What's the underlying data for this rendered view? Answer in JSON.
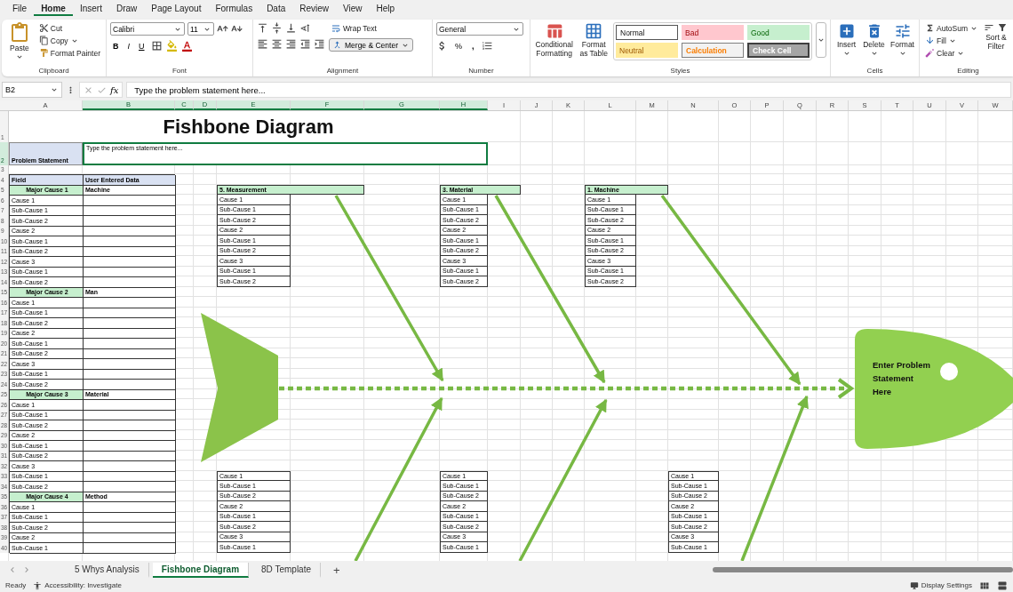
{
  "menu": [
    {
      "label": "File",
      "selected": false
    },
    {
      "label": "Home",
      "selected": true
    },
    {
      "label": "Insert",
      "selected": false
    },
    {
      "label": "Draw",
      "selected": false
    },
    {
      "label": "Page Layout",
      "selected": false
    },
    {
      "label": "Formulas",
      "selected": false
    },
    {
      "label": "Data",
      "selected": false
    },
    {
      "label": "Review",
      "selected": false
    },
    {
      "label": "View",
      "selected": false
    },
    {
      "label": "Help",
      "selected": false
    }
  ],
  "ribbon": [
    {
      "kind": "clipboard",
      "label": "Clipboard",
      "paste": "Paste",
      "cut": "Cut",
      "copy": "Copy",
      "format_painter": "Format Painter"
    },
    {
      "kind": "font",
      "label": "Font",
      "font_name": "Calibri",
      "font_size": "11",
      "bold": "B",
      "italic": "I",
      "underline": "U"
    },
    {
      "kind": "alignment",
      "label": "Alignment",
      "wrap_text": "Wrap Text",
      "merge_center": "Merge & Center"
    },
    {
      "kind": "number",
      "label": "Number",
      "format": "General",
      "percent": "%",
      "comma": ","
    },
    {
      "kind": "styles",
      "label": "Styles",
      "conditional_formatting": "Conditional Formatting",
      "format_as_table": "Format as Table",
      "cell_styles": [
        {
          "kind": "normal",
          "label": "Normal"
        },
        {
          "kind": "bad",
          "label": "Bad"
        },
        {
          "kind": "good",
          "label": "Good"
        },
        {
          "kind": "neutral",
          "label": "Neutral"
        },
        {
          "kind": "calculation",
          "label": "Calculation"
        },
        {
          "kind": "check",
          "label": "Check Cell"
        }
      ]
    },
    {
      "kind": "cells",
      "label": "Cells",
      "insert": "Insert",
      "delete": "Delete",
      "format": "Format"
    },
    {
      "kind": "editing",
      "label": "Editing",
      "autosum": "AutoSum",
      "fill": "Fill",
      "clear": "Clear",
      "sort_filter": "Sort & Filter"
    }
  ],
  "formula_bar": {
    "name_box": "B2",
    "function_label": "fx",
    "formula": "Type the problem statement here..."
  },
  "sheet": {
    "column_headers": [
      {
        "label": "A",
        "selected": false
      },
      {
        "label": "B",
        "selected": true
      },
      {
        "label": "C",
        "selected": true
      },
      {
        "label": "D",
        "selected": true
      },
      {
        "label": "E",
        "selected": true
      },
      {
        "label": "F",
        "selected": true
      },
      {
        "label": "G",
        "selected": true
      },
      {
        "label": "H",
        "selected": true
      },
      {
        "label": "I",
        "selected": false
      },
      {
        "label": "J",
        "selected": false
      },
      {
        "label": "K",
        "selected": false
      },
      {
        "label": "L",
        "selected": false
      },
      {
        "label": "M",
        "selected": false
      },
      {
        "label": "N",
        "selected": false
      },
      {
        "label": "O",
        "selected": false
      },
      {
        "label": "P",
        "selected": false
      },
      {
        "label": "Q",
        "selected": false
      },
      {
        "label": "R",
        "selected": false
      },
      {
        "label": "S",
        "selected": false
      },
      {
        "label": "T",
        "selected": false
      },
      {
        "label": "U",
        "selected": false
      },
      {
        "label": "V",
        "selected": false
      },
      {
        "label": "W",
        "selected": false
      }
    ],
    "row_headers": [
      {
        "label": "1",
        "selected": false
      },
      {
        "label": "2",
        "selected": true
      },
      {
        "label": "3",
        "selected": false
      },
      {
        "label": "4",
        "selected": false
      },
      {
        "label": "5",
        "selected": false
      },
      {
        "label": "6",
        "selected": false
      },
      {
        "label": "7",
        "selected": false
      },
      {
        "label": "8",
        "selected": false
      },
      {
        "label": "9",
        "selected": false
      },
      {
        "label": "10",
        "selected": false
      },
      {
        "label": "11",
        "selected": false
      },
      {
        "label": "12",
        "selected": false
      },
      {
        "label": "13",
        "selected": false
      },
      {
        "label": "14",
        "selected": false
      },
      {
        "label": "15",
        "selected": false
      },
      {
        "label": "16",
        "selected": false
      },
      {
        "label": "17",
        "selected": false
      },
      {
        "label": "18",
        "selected": false
      },
      {
        "label": "19",
        "selected": false
      },
      {
        "label": "20",
        "selected": false
      },
      {
        "label": "21",
        "selected": false
      },
      {
        "label": "22",
        "selected": false
      },
      {
        "label": "23",
        "selected": false
      },
      {
        "label": "24",
        "selected": false
      },
      {
        "label": "25",
        "selected": false
      },
      {
        "label": "26",
        "selected": false
      },
      {
        "label": "27",
        "selected": false
      },
      {
        "label": "28",
        "selected": false
      },
      {
        "label": "29",
        "selected": false
      },
      {
        "label": "30",
        "selected": false
      },
      {
        "label": "31",
        "selected": false
      },
      {
        "label": "32",
        "selected": false
      },
      {
        "label": "33",
        "selected": false
      },
      {
        "label": "34",
        "selected": false
      },
      {
        "label": "35",
        "selected": false
      },
      {
        "label": "36",
        "selected": false
      },
      {
        "label": "37",
        "selected": false
      },
      {
        "label": "38",
        "selected": false
      },
      {
        "label": "39",
        "selected": false
      },
      {
        "label": "40",
        "selected": false
      }
    ],
    "title": "Fishbone Diagram",
    "problem_label": "Problem Statement",
    "problem_value": "Type the problem statement here...",
    "data_table": {
      "columns": [
        "Field",
        "User Entered Data"
      ],
      "rows": [
        {
          "kind": "major",
          "field": "Major Cause 1",
          "value": "Machine"
        },
        {
          "kind": "cause",
          "field": "Cause 1"
        },
        {
          "kind": "cause",
          "field": "Sub-Cause 1"
        },
        {
          "kind": "cause",
          "field": "Sub-Cause 2"
        },
        {
          "kind": "cause",
          "field": "Cause 2"
        },
        {
          "kind": "cause",
          "field": "Sub-Cause 1"
        },
        {
          "kind": "cause",
          "field": "Sub-Cause 2"
        },
        {
          "kind": "cause",
          "field": "Cause 3"
        },
        {
          "kind": "cause",
          "field": "Sub-Cause 1"
        },
        {
          "kind": "cause",
          "field": "Sub-Cause 2"
        },
        {
          "kind": "major",
          "field": "Major Cause 2",
          "value": "Man"
        },
        {
          "kind": "cause",
          "field": "Cause 1"
        },
        {
          "kind": "cause",
          "field": "Sub-Cause 1"
        },
        {
          "kind": "cause",
          "field": "Sub-Cause 2"
        },
        {
          "kind": "cause",
          "field": "Cause 2"
        },
        {
          "kind": "cause",
          "field": "Sub-Cause 1"
        },
        {
          "kind": "cause",
          "field": "Sub-Cause 2"
        },
        {
          "kind": "cause",
          "field": "Cause 3"
        },
        {
          "kind": "cause",
          "field": "Sub-Cause 1"
        },
        {
          "kind": "cause",
          "field": "Sub-Cause 2"
        },
        {
          "kind": "major",
          "field": "Major Cause 3",
          "value": "Material"
        },
        {
          "kind": "cause",
          "field": "Cause 1"
        },
        {
          "kind": "cause",
          "field": "Sub-Cause 1"
        },
        {
          "kind": "cause",
          "field": "Sub-Cause 2"
        },
        {
          "kind": "cause",
          "field": "Cause 2"
        },
        {
          "kind": "cause",
          "field": "Sub-Cause 1"
        },
        {
          "kind": "cause",
          "field": "Sub-Cause 2"
        },
        {
          "kind": "cause",
          "field": "Cause 3"
        },
        {
          "kind": "cause",
          "field": "Sub-Cause 1"
        },
        {
          "kind": "cause",
          "field": "Sub-Cause 2"
        },
        {
          "kind": "major",
          "field": "Major Cause 4",
          "value": "Method"
        },
        {
          "kind": "cause",
          "field": "Cause 1"
        },
        {
          "kind": "cause",
          "field": "Sub-Cause 1"
        },
        {
          "kind": "cause",
          "field": "Sub-Cause 2"
        },
        {
          "kind": "cause",
          "field": "Cause 2"
        },
        {
          "kind": "cause",
          "field": "Sub-Cause 1"
        }
      ]
    },
    "cause_boxes": [
      {
        "title": "5. Measurement",
        "items": [
          "Cause 1",
          "Sub-Cause 1",
          "Sub-Cause 2",
          "Cause 2",
          "Sub-Cause 1",
          "Sub-Cause 2",
          "Cause 3",
          "Sub-Cause 1",
          "Sub-Cause 2"
        ]
      },
      {
        "title": "3. Material",
        "items": [
          "Cause 1",
          "Sub-Cause 1",
          "Sub-Cause 2",
          "Cause 2",
          "Sub-Cause 1",
          "Sub-Cause 2",
          "Cause 3",
          "Sub-Cause 1",
          "Sub-Cause 2"
        ]
      },
      {
        "title": "1. Machine",
        "items": [
          "Cause 1",
          "Sub-Cause 1",
          "Sub-Cause 2",
          "Cause 2",
          "Sub-Cause 1",
          "Sub-Cause 2",
          "Cause 3",
          "Sub-Cause 1",
          "Sub-Cause 2"
        ]
      },
      {
        "items": [
          "Cause 1",
          "Sub-Cause 1",
          "Sub-Cause 2",
          "Cause 2",
          "Sub-Cause 1",
          "Sub-Cause 2",
          "Cause 3",
          "Sub-Cause 1"
        ]
      },
      {
        "items": [
          "Cause 1",
          "Sub-Cause 1",
          "Sub-Cause 2",
          "Cause 2",
          "Sub-Cause 1",
          "Sub-Cause 2",
          "Cause 3",
          "Sub-Cause 1"
        ]
      },
      {
        "items": [
          "Cause 1",
          "Sub-Cause 1",
          "Sub-Cause 2",
          "Cause 2",
          "Sub-Cause 1",
          "Sub-Cause 2",
          "Cause 3",
          "Sub-Cause 1"
        ]
      }
    ],
    "fish_head": {
      "text": "Enter Problem Statement Here"
    }
  },
  "sheet_tabs": [
    {
      "label": "5 Whys Analysis",
      "selected": false
    },
    {
      "label": "Fishbone Diagram",
      "selected": true
    },
    {
      "label": "8D Template",
      "selected": false
    }
  ],
  "add_sheet": "+",
  "status_bar": {
    "ready": "Ready",
    "accessibility": "Accessibility: Investigate",
    "display_settings": "Display Settings"
  }
}
